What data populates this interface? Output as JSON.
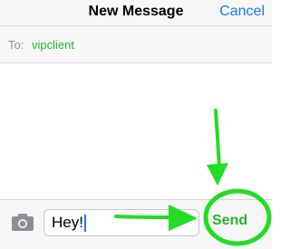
{
  "nav": {
    "title": "New Message",
    "cancel_label": "Cancel"
  },
  "recipient": {
    "label": "To:",
    "name": "vipclient"
  },
  "compose": {
    "camera_icon": "camera-icon",
    "message_value": "Hey!",
    "send_label": "Send"
  },
  "annotations": {
    "color": "#22dd22",
    "items": [
      "down-arrow-annotation",
      "right-arrow-annotation",
      "circle-annotation"
    ]
  },
  "colors": {
    "accent_blue": "#1a7cf6",
    "recipient_green": "#2ab42a",
    "bar_background": "#f7f7f7"
  }
}
